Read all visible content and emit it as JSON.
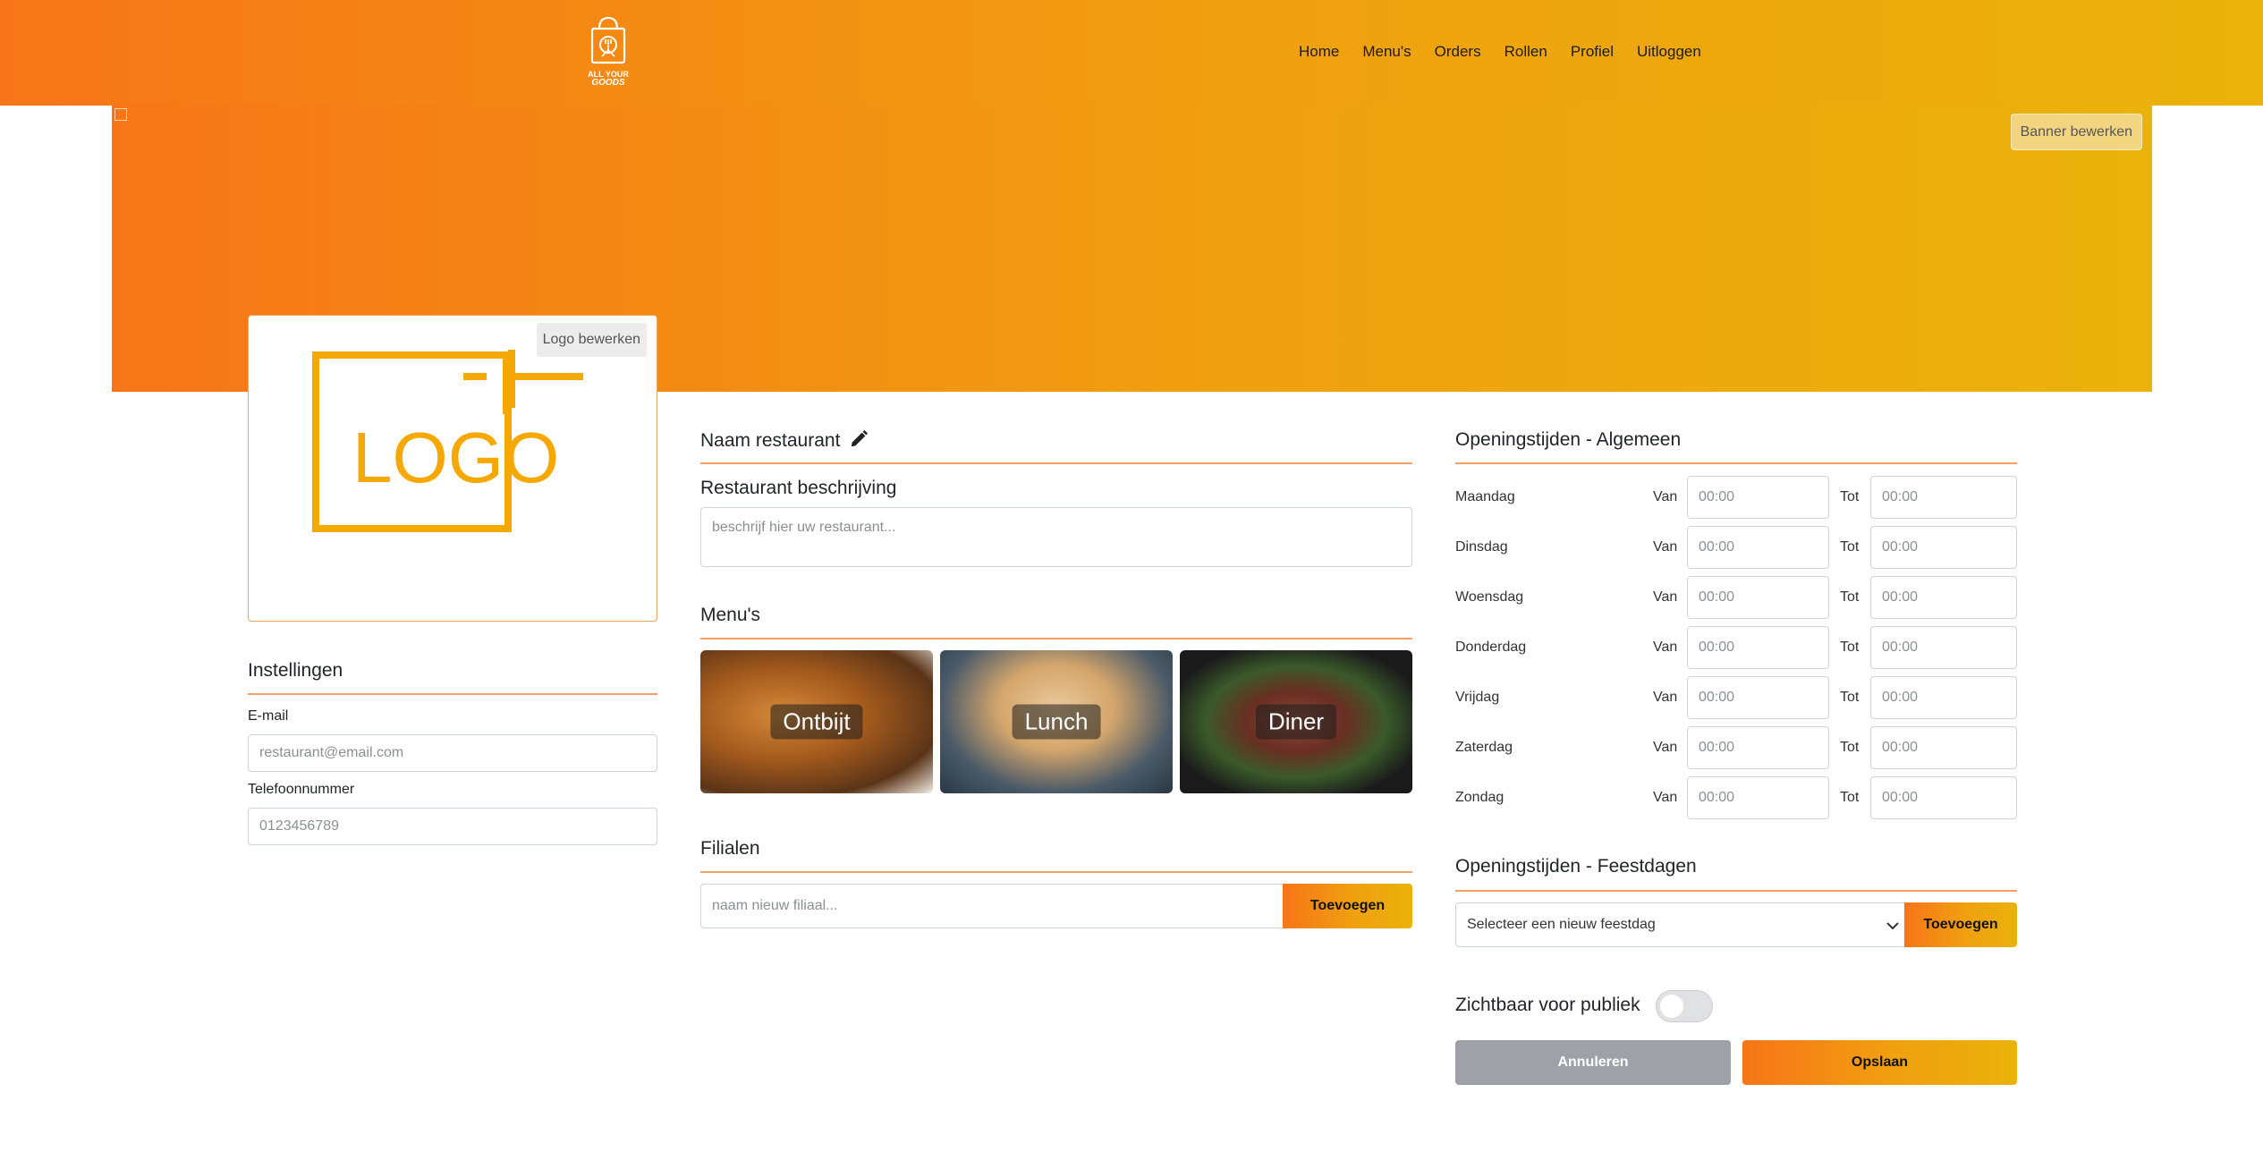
{
  "navbar": {
    "brand_line1": "ALL YOUR",
    "brand_line2": "GOODS",
    "links": [
      "Home",
      "Menu's",
      "Orders",
      "Rollen",
      "Profiel",
      "Uitloggen"
    ]
  },
  "banner": {
    "edit_label": "Banner bewerken"
  },
  "logo": {
    "text": "LOGO",
    "edit_label": "Logo bewerken"
  },
  "settings": {
    "title": "Instellingen",
    "email_label": "E-mail",
    "email_placeholder": "restaurant@email.com",
    "phone_label": "Telefoonnummer",
    "phone_placeholder": "0123456789"
  },
  "restaurant": {
    "name": "Naam restaurant",
    "description_label": "Restaurant beschrijving",
    "description_placeholder": "beschrijf hier uw restaurant..."
  },
  "menus": {
    "title": "Menu's",
    "items": [
      "Ontbijt",
      "Lunch",
      "Diner"
    ]
  },
  "branches": {
    "title": "Filialen",
    "input_placeholder": "naam nieuw filiaal...",
    "add_label": "Toevoegen"
  },
  "opening_hours": {
    "title": "Openingstijden - Algemeen",
    "from_label": "Van",
    "to_label": "Tot",
    "days": [
      {
        "name": "Maandag",
        "from": "00:00",
        "to": "00:00"
      },
      {
        "name": "Dinsdag",
        "from": "00:00",
        "to": "00:00"
      },
      {
        "name": "Woensdag",
        "from": "00:00",
        "to": "00:00"
      },
      {
        "name": "Donderdag",
        "from": "00:00",
        "to": "00:00"
      },
      {
        "name": "Vrijdag",
        "from": "00:00",
        "to": "00:00"
      },
      {
        "name": "Zaterdag",
        "from": "00:00",
        "to": "00:00"
      },
      {
        "name": "Zondag",
        "from": "00:00",
        "to": "00:00"
      }
    ]
  },
  "holidays": {
    "title": "Openingstijden - Feestdagen",
    "select_value": "Selecteer een nieuw feestdag",
    "add_label": "Toevoegen"
  },
  "visibility": {
    "label": "Zichtbaar voor publiek",
    "enabled": false
  },
  "actions": {
    "cancel_label": "Annuleren",
    "save_label": "Opslaan"
  },
  "colors": {
    "accent_start": "#f77518",
    "accent_end": "#eab20a",
    "logo_color": "#f5a800"
  }
}
